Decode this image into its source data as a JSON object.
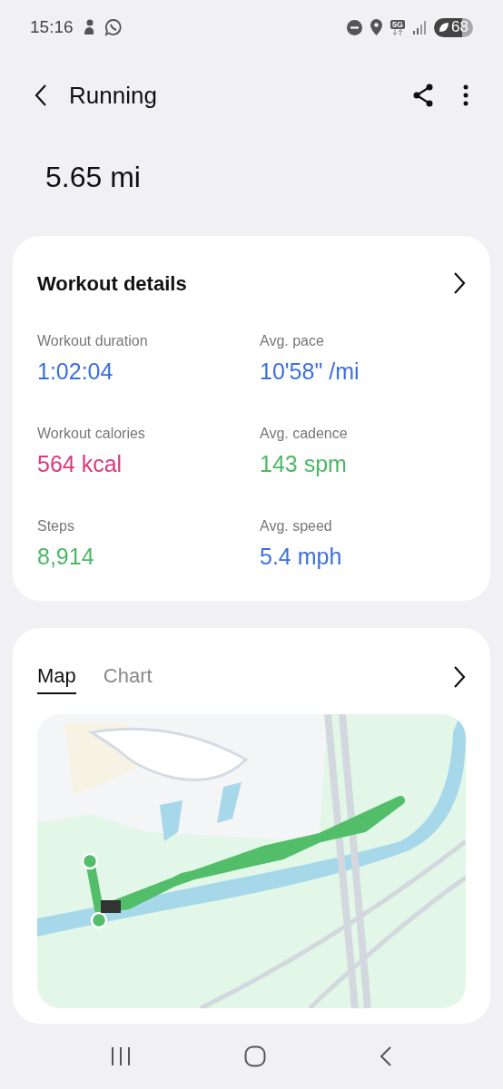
{
  "status_bar": {
    "time": "15:16",
    "network": "5G",
    "battery": "68"
  },
  "header": {
    "title": "Running"
  },
  "distance": "5.65 mi",
  "workout_details": {
    "title": "Workout details",
    "stats": [
      {
        "label": "Workout duration",
        "value": "1:02:04",
        "color": "#3b6fe0"
      },
      {
        "label": "Avg. pace",
        "value": "10'58\" /mi",
        "color": "#3b6fe0"
      },
      {
        "label": "Workout calories",
        "value": "564 kcal",
        "color": "#e0367a"
      },
      {
        "label": "Avg. cadence",
        "value": "143 spm",
        "color": "#4cb865"
      },
      {
        "label": "Steps",
        "value": "8,914",
        "color": "#4cb865"
      },
      {
        "label": "Avg. speed",
        "value": "5.4 mph",
        "color": "#3b6fe0"
      }
    ]
  },
  "route_card": {
    "tabs": [
      {
        "label": "Map",
        "selected": true
      },
      {
        "label": "Chart",
        "selected": false
      }
    ]
  }
}
